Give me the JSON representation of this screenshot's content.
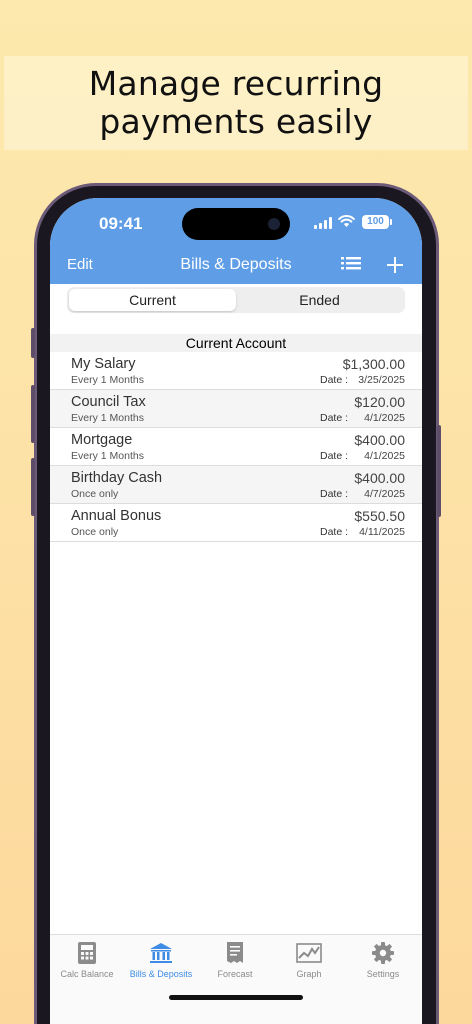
{
  "headline": {
    "line1": "Manage recurring",
    "line2": "payments easily"
  },
  "status_bar": {
    "time": "09:41",
    "battery": "100"
  },
  "nav": {
    "edit": "Edit",
    "title": "Bills & Deposits"
  },
  "segments": [
    {
      "label": "Current",
      "selected": true
    },
    {
      "label": "Ended",
      "selected": false
    }
  ],
  "section_title": "Current Account",
  "date_label": "Date :",
  "items": [
    {
      "name": "My Salary",
      "frequency": "Every 1 Months",
      "amount": "$1,300.00",
      "date": "3/25/2025"
    },
    {
      "name": "Council Tax",
      "frequency": "Every 1 Months",
      "amount": "$120.00",
      "date": "4/1/2025"
    },
    {
      "name": "Mortgage",
      "frequency": "Every 1 Months",
      "amount": "$400.00",
      "date": "4/1/2025"
    },
    {
      "name": "Birthday Cash",
      "frequency": "Once only",
      "amount": "$400.00",
      "date": "4/7/2025"
    },
    {
      "name": "Annual Bonus",
      "frequency": "Once only",
      "amount": "$550.50",
      "date": "4/11/2025"
    }
  ],
  "tabs": [
    {
      "label": "Calc Balance",
      "icon": "calculator-icon",
      "active": false
    },
    {
      "label": "Bills & Deposits",
      "icon": "bank-icon",
      "active": true
    },
    {
      "label": "Forecast",
      "icon": "receipt-icon",
      "active": false
    },
    {
      "label": "Graph",
      "icon": "graph-icon",
      "active": false
    },
    {
      "label": "Settings",
      "icon": "gear-icon",
      "active": false
    }
  ],
  "colors": {
    "nav_blue": "#5f9ee6",
    "active_tab": "#3e8ce6",
    "background_top": "#fde9ad",
    "background_bottom": "#fdd89c"
  }
}
